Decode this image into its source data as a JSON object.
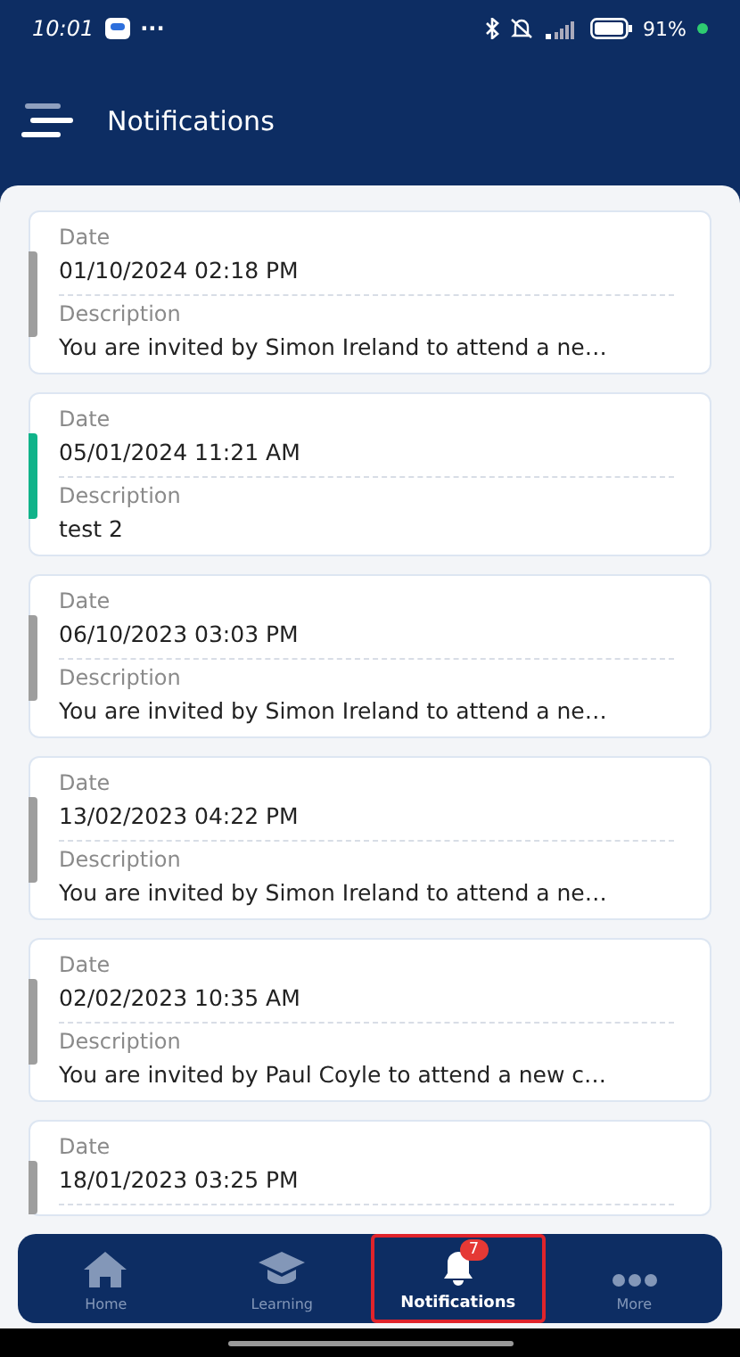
{
  "status_bar": {
    "time": "10:01",
    "more": "···",
    "battery": "91%"
  },
  "header": {
    "title": "Notifications"
  },
  "notifications": [
    {
      "date_label": "Date",
      "date": "01/10/2024 02:18 PM",
      "description_label": "Description",
      "description": "You are invited by Simon Ireland to attend a ne…",
      "color": "#9e9e9e"
    },
    {
      "date_label": "Date",
      "date": "05/01/2024 11:21 AM",
      "description_label": "Description",
      "description": "test 2",
      "color": "#10b38a"
    },
    {
      "date_label": "Date",
      "date": "06/10/2023 03:03 PM",
      "description_label": "Description",
      "description": "You are invited by Simon Ireland to attend a ne…",
      "color": "#9e9e9e"
    },
    {
      "date_label": "Date",
      "date": "13/02/2023 04:22 PM",
      "description_label": "Description",
      "description": "You are invited by Simon Ireland to attend a ne…",
      "color": "#9e9e9e"
    },
    {
      "date_label": "Date",
      "date": "02/02/2023 10:35 AM",
      "description_label": "Description",
      "description": "You are invited by Paul Coyle to attend a new c…",
      "color": "#9e9e9e"
    },
    {
      "date_label": "Date",
      "date": "18/01/2023 03:25 PM",
      "color": "#9e9e9e"
    }
  ],
  "tabs": [
    {
      "kind": "home",
      "label": "Home",
      "selected": false,
      "highlighted": false
    },
    {
      "kind": "learning",
      "label": "Learning",
      "selected": false,
      "highlighted": false
    },
    {
      "kind": "notifications",
      "label": "Notifications",
      "selected": true,
      "highlighted": true,
      "badge": "7"
    },
    {
      "kind": "more",
      "label": "More",
      "selected": false,
      "highlighted": false
    }
  ]
}
